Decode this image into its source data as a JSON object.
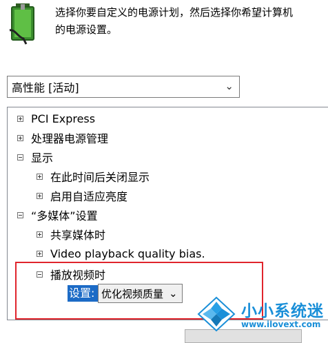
{
  "description": {
    "line1": "选择你要自定义的电源计划，然后选择你希望计算机",
    "line2": "的电源设置。"
  },
  "plan_select": {
    "value": "高性能 [活动]"
  },
  "tree": {
    "items": [
      {
        "label": "PCI Express",
        "expander": "plus"
      },
      {
        "label": "处理器电源管理",
        "expander": "plus"
      },
      {
        "label": "显示",
        "expander": "minus"
      },
      {
        "label": "在此时间后关闭显示",
        "expander": "plus"
      },
      {
        "label": "启用自适应亮度",
        "expander": "plus"
      },
      {
        "label": "“多媒体”设置",
        "expander": "minus"
      },
      {
        "label": "共享媒体时",
        "expander": "plus"
      },
      {
        "label": "Video playback quality bias.",
        "expander": "plus"
      },
      {
        "label": "播放视频时",
        "expander": "minus"
      }
    ],
    "setting": {
      "label": "设置:",
      "value": "优化视频质量"
    }
  },
  "watermark": {
    "title": "小小系统迷",
    "url": "www.ilovext.com"
  },
  "colors": {
    "highlight_border": "#e0242c",
    "selection": "#1c6bc6",
    "watermark": "#1a8fd8"
  }
}
